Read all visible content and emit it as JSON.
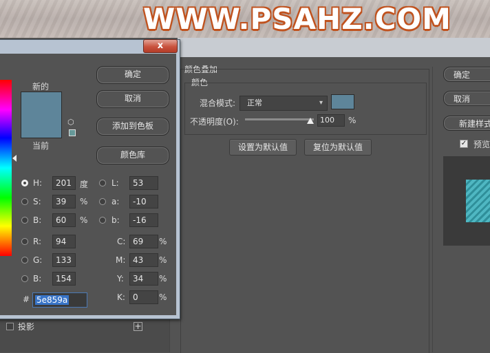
{
  "watermark": {
    "text": "WWW.PSAHZ.COM"
  },
  "color_overlay": {
    "section_title": "颜色叠加",
    "group_title": "颜色",
    "blend_mode_label": "混合模式:",
    "blend_mode_value": "正常",
    "opacity_label": "不透明度(O):",
    "opacity_value": "100",
    "opacity_unit": "%",
    "overlay_color": "#5e859a",
    "set_default_button": "设置为默认值",
    "reset_default_button": "复位为默认值"
  },
  "right_panel": {
    "ok_button": "确定",
    "cancel_button": "取消",
    "new_style_button": "新建样式",
    "preview_label": "预览",
    "preview_checked": true
  },
  "layer_styles": {
    "drop_shadow_label": "投影"
  },
  "color_picker": {
    "close_symbol": "x",
    "new_label": "新的",
    "current_label": "当前",
    "new_color": "#5e859a",
    "current_color": "#5e859a",
    "ok_button": "确定",
    "cancel_button": "取消",
    "add_to_swatches_button": "添加到色板",
    "color_libraries_button": "颜色库",
    "hsb": {
      "h_label": "H:",
      "h_value": "201",
      "h_unit": "度",
      "s_label": "S:",
      "s_value": "39",
      "s_unit": "%",
      "b_label": "B:",
      "b_value": "60",
      "b_unit": "%"
    },
    "lab": {
      "l_label": "L:",
      "l_value": "53",
      "a_label": "a:",
      "a_value": "-10",
      "b_label": "b:",
      "b_value": "-16"
    },
    "rgb": {
      "r_label": "R:",
      "r_value": "94",
      "g_label": "G:",
      "g_value": "133",
      "b_label": "B:",
      "b_value": "154"
    },
    "cmyk": {
      "c_label": "C:",
      "c_value": "69",
      "c_unit": "%",
      "m_label": "M:",
      "m_value": "43",
      "m_unit": "%",
      "y_label": "Y:",
      "y_value": "34",
      "y_unit": "%",
      "k_label": "K:",
      "k_value": "0",
      "k_unit": "%"
    },
    "hex_label": "#",
    "hex_value": "5e859a",
    "selected_mode": "H"
  }
}
